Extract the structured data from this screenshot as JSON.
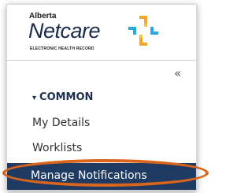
{
  "logo": {
    "region": "Alberta",
    "name": "Netcare",
    "tagline": "ELECTRONIC HEALTH RECORD"
  },
  "sidebar": {
    "collapse_glyph": "«",
    "section": {
      "expand_glyph": "▾",
      "label": "COMMON"
    },
    "items": [
      {
        "label": "My Details",
        "active": false
      },
      {
        "label": "Worklists",
        "active": false
      },
      {
        "label": "Manage Notifications",
        "active": true
      }
    ]
  },
  "colors": {
    "active_bg": "#1f3b63",
    "highlight_ring": "#d9651c",
    "logo_orange": "#f5a623",
    "logo_blue": "#29a8e0"
  },
  "icons": {
    "collapse": "double-chevron-left-icon",
    "section_toggle": "caret-down-icon",
    "logo_mark": "netcare-cross-icon"
  }
}
